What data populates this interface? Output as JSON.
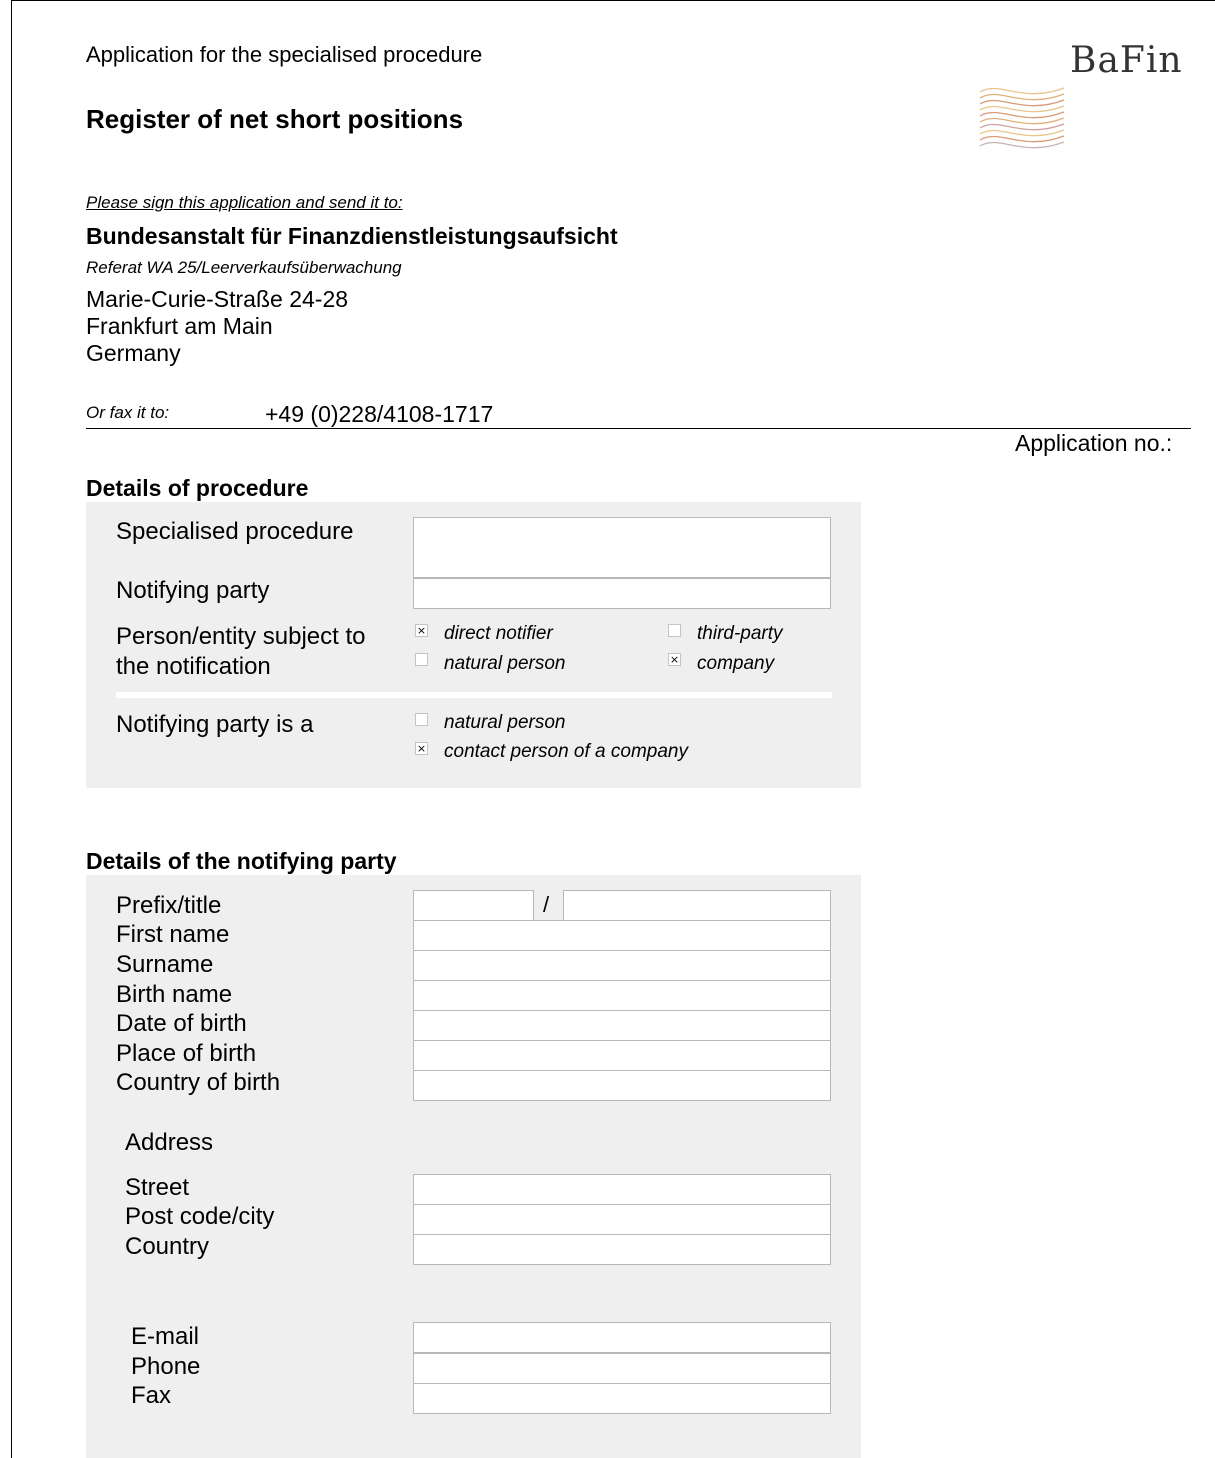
{
  "header": {
    "title": "Application for the specialised procedure",
    "subtitle": "Register of net short positions",
    "logo_text": "BaFin"
  },
  "recipient": {
    "note": "Please sign this application and send it to:",
    "org": "Bundesanstalt für Finanzdienstleistungsaufsicht",
    "dept": "Referat WA 25/Leerverkaufsüberwachung",
    "street": "Marie-Curie-Straße 24-28",
    "city": "Frankfurt am Main",
    "country": "Germany",
    "fax_label": "Or fax it to:",
    "fax_number": "+49 (0)228/4108-1717"
  },
  "application_no_label": "Application no.:",
  "procedure": {
    "heading": "Details of procedure",
    "specialised_procedure_label": "Specialised procedure",
    "specialised_procedure_value": "",
    "notifying_party_label": "Notifying party",
    "notifying_party_value": "",
    "subject_label_1": "Person/entity subject to",
    "subject_label_2": "the notification",
    "options": {
      "direct_notifier": {
        "label": "direct notifier",
        "checked": true
      },
      "third_party": {
        "label": "third-party",
        "checked": false
      },
      "natural_person": {
        "label": "natural person",
        "checked": false
      },
      "company": {
        "label": "company",
        "checked": true
      }
    },
    "party_is_label": "Notifying party is a",
    "party_options": {
      "natural_person": {
        "label": "natural person",
        "checked": false
      },
      "contact_person": {
        "label": "contact person of a company",
        "checked": true
      }
    }
  },
  "notifying_party": {
    "heading": "Details of the notifying party",
    "prefix_label": "Prefix/title",
    "prefix_separator": "/",
    "prefix_value": "",
    "title_value": "",
    "first_name_label": "First name",
    "first_name_value": "",
    "surname_label": "Surname",
    "surname_value": "",
    "birth_name_label": "Birth name",
    "birth_name_value": "",
    "dob_label": "Date of birth",
    "dob_value": "",
    "place_of_birth_label": "Place of birth",
    "place_of_birth_value": "",
    "country_of_birth_label": "Country of birth",
    "country_of_birth_value": "",
    "address_heading": "Address",
    "street_label": "Street",
    "street_value": "",
    "postcode_label": "Post code/city",
    "postcode_value": "",
    "country_label": "Country",
    "country_value": "",
    "email_label": "E-mail",
    "email_value": "",
    "phone_label": "Phone",
    "phone_value": "",
    "fax_label": "Fax",
    "fax_value": ""
  },
  "checkbox_mark": "×"
}
